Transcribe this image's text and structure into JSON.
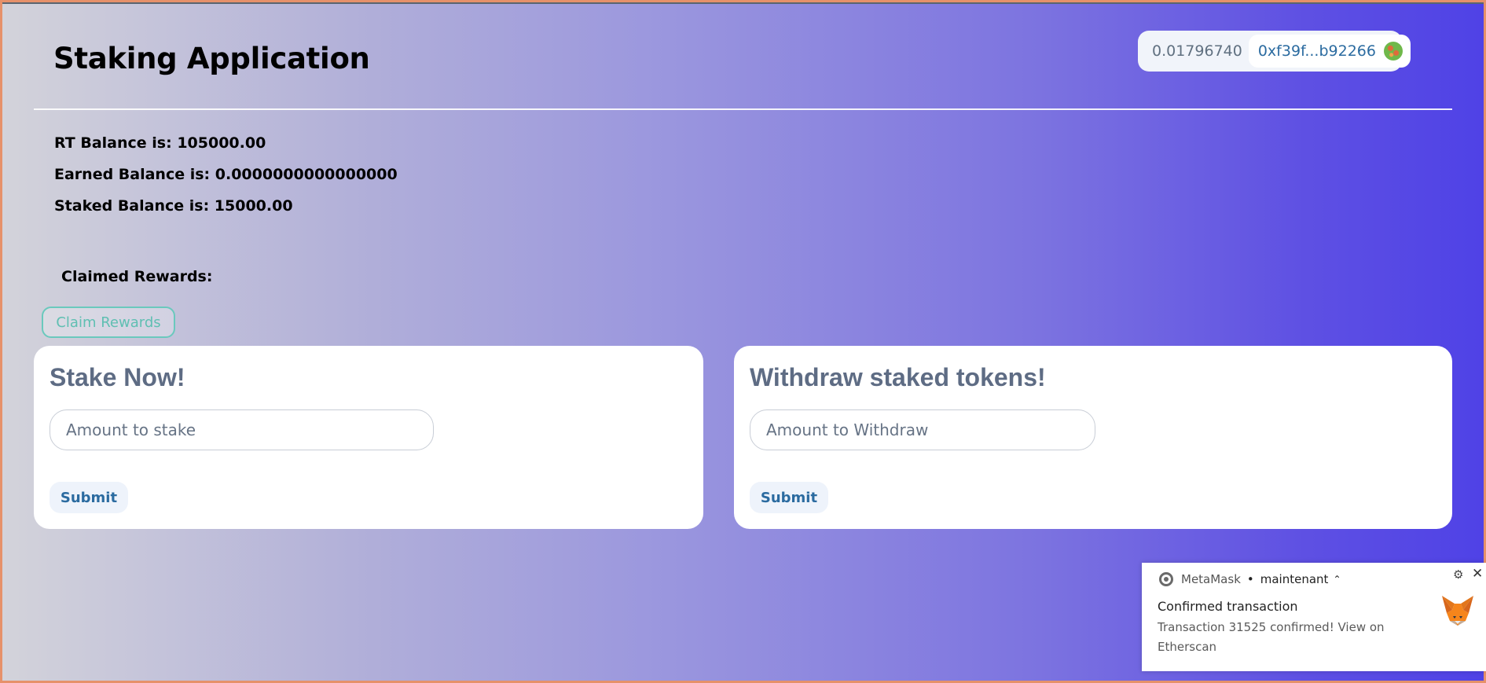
{
  "header": {
    "title": "Staking Application",
    "wallet_balance": "0.01796740",
    "wallet_address": "0xf39f...b92266"
  },
  "balances": {
    "rt": "RT Balance is: 105000.00",
    "earned": "Earned Balance is: 0.0000000000000000",
    "staked": "Staked Balance is: 15000.00"
  },
  "rewards": {
    "claimed_label": "Claimed Rewards:",
    "claim_button": "Claim Rewards"
  },
  "stake_card": {
    "title": "Stake Now!",
    "input_placeholder": "Amount to stake",
    "submit_label": "Submit"
  },
  "withdraw_card": {
    "title": "Withdraw staked tokens!",
    "input_placeholder": "Amount to Withdraw",
    "submit_label": "Submit"
  },
  "notification": {
    "app_name": "MetaMask",
    "separator": "•",
    "time": "maintenant",
    "title": "Confirmed transaction",
    "body": "Transaction 31525 confirmed! View on Etherscan"
  },
  "icons": {
    "wallet_avatar": "identicon-avatar",
    "chrome": "chrome-icon",
    "metamask": "metamask-fox-icon",
    "settings": "gear-icon",
    "close": "close-icon",
    "expand": "chevron-up-icon"
  }
}
